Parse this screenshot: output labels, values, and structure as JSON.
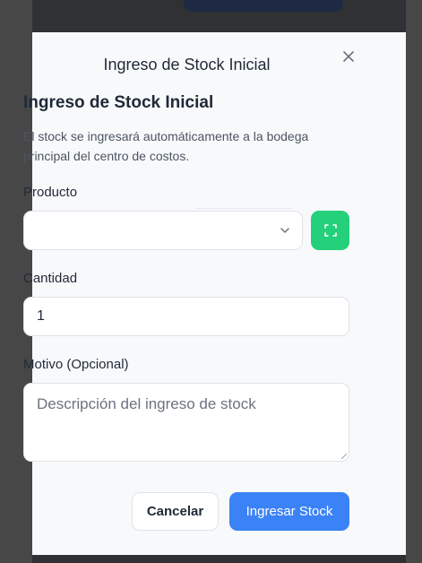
{
  "modal": {
    "title": "Ingreso de Stock Inicial",
    "heading": "Ingreso de Stock Inicial",
    "description": "El stock se ingresará automáticamente a la bodega principal del centro de costos."
  },
  "form": {
    "product_label": "Producto",
    "product_value": "",
    "quantity_label": "Cantidad",
    "quantity_value": "1",
    "reason_label": "Motivo (Opcional)",
    "reason_placeholder": "Descripción del ingreso de stock"
  },
  "actions": {
    "cancel_label": "Cancelar",
    "submit_label": "Ingresar Stock"
  },
  "icons": {
    "close": "close-icon",
    "chevron": "chevron-down-icon",
    "scan": "scan-icon"
  },
  "colors": {
    "primary": "#3b82f6",
    "scan_button": "#25d07a",
    "modal_bg": "#f8f9fb"
  }
}
